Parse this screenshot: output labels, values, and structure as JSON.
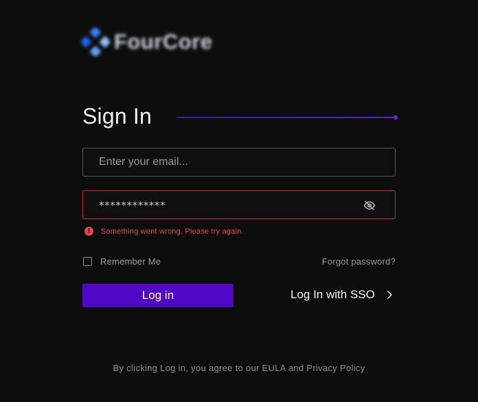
{
  "brand": {
    "name": "FourCore",
    "logo_icon": "fourcore-logo-icon"
  },
  "heading": {
    "title": "Sign In"
  },
  "form": {
    "email": {
      "placeholder": "Enter your email...",
      "value": ""
    },
    "password": {
      "masked_value": "************",
      "toggle_icon": "eye-off-icon"
    },
    "error": {
      "message": "Something went wrong. Please try again.",
      "icon": "!",
      "color": "#e5484d"
    },
    "remember_me": {
      "label": "Remember Me",
      "checked": false
    },
    "forgot_password": "Forgot password?",
    "login_button": "Log in",
    "sso_button": "Log In with SSO"
  },
  "footer": {
    "text": "By clicking Log in, you agree to our EULA and Privacy Policy"
  },
  "colors": {
    "accent": "#5108c4",
    "error": "#e5484d",
    "background": "#0d0d0e"
  }
}
